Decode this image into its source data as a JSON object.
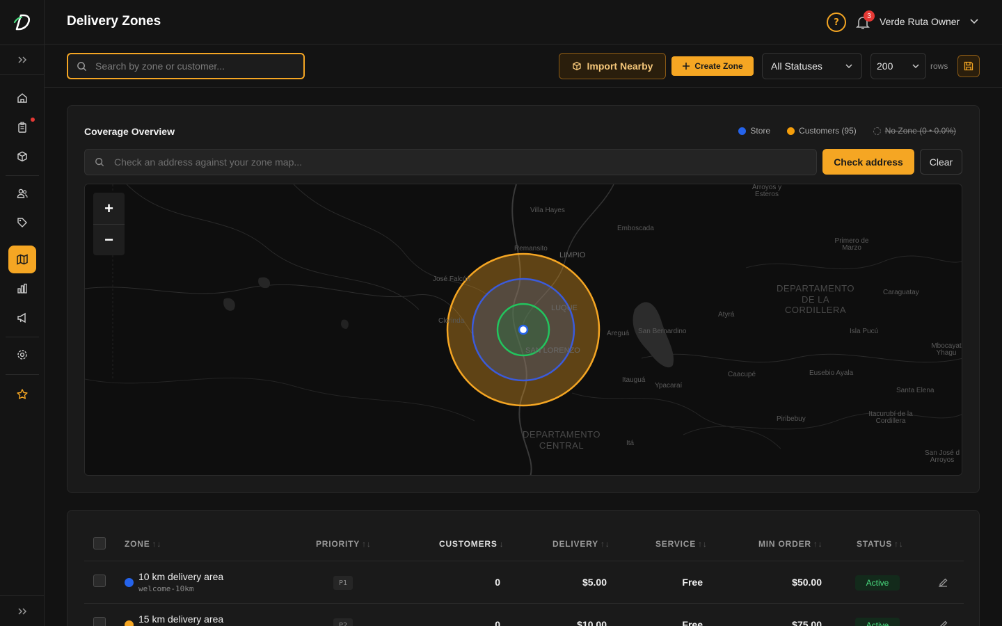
{
  "header": {
    "title": "Delivery Zones",
    "notification_count": "3",
    "user_name": "Verde Ruta Owner",
    "help_glyph": "?"
  },
  "toolbar": {
    "search_placeholder": "Search by zone or customer...",
    "import_label": "Import Nearby",
    "create_label": "Create Zone",
    "status_value": "All Statuses",
    "rows_value": "200",
    "rows_label": "rows"
  },
  "coverage": {
    "title": "Coverage Overview",
    "legend": [
      {
        "label": "Store",
        "color": "#2563eb"
      },
      {
        "label": "Customers (95)",
        "color": "#f59e0b"
      },
      {
        "label": "No Zone (0 • 0.0%)",
        "color": "#666666"
      }
    ],
    "address_placeholder": "Check an address against your zone map...",
    "check_label": "Check address",
    "clear_label": "Clear",
    "zoom_in": "+",
    "zoom_out": "−",
    "map_labels": {
      "arroyos": "Arroyos y Esteros",
      "villa_hayes": "Villa Hayes",
      "emboscada": "Emboscada",
      "primero_de_marzo": "Primero de Marzo",
      "remansito": "Remansito",
      "limpio": "LIMPIO",
      "jose_falcon": "José Falcón",
      "luque": "LUQUE",
      "clorinda": "Clorinda",
      "san_lorenzo": "SAN LORENZO",
      "areguá": "Areguá",
      "san_bernardino": "San Bernardino",
      "atyra": "Atyrá",
      "dept_cordillera": "DEPARTAMENTO DE LA CORDILLERA",
      "caraguatay": "Caraguatay",
      "isla_pucu": "Isla Pucú",
      "mbocayaty": "Mbocayat Yhagu",
      "itagua": "Itauguá",
      "ypacarai": "Ypacaraí",
      "caacupe": "Caacupé",
      "eusebio_ayala": "Eusebio Ayala",
      "santa_elena": "Santa Elena",
      "piribebuy": "Piribebuy",
      "itacurubi": "Itacurubí de la Cordillera",
      "dept_central": "DEPARTAMENTO CENTRAL",
      "ita": "Itá",
      "san_jose": "San José d Arroyos"
    },
    "zone_colors": {
      "inner": "#22c55e",
      "middle": "#3b5bdb",
      "outer": "#f5a623"
    }
  },
  "table": {
    "columns": [
      "ZONE",
      "PRIORITY",
      "CUSTOMERS",
      "DELIVERY",
      "SERVICE",
      "MIN ORDER",
      "STATUS"
    ],
    "sort_glyph": "↑↓",
    "sort_active_glyph": "↓",
    "rows": [
      {
        "color": "#2563eb",
        "name": "10 km delivery area",
        "code": "welcome-10km",
        "priority": "P1",
        "customers": "0",
        "delivery": "$5.00",
        "service": "Free",
        "min_order": "$50.00",
        "status": "Active"
      },
      {
        "color": "#f5a623",
        "name": "15 km delivery area",
        "code": "",
        "priority": "P2",
        "customers": "0",
        "delivery": "$10.00",
        "service": "Free",
        "min_order": "$75.00",
        "status": "Active"
      }
    ]
  },
  "colors": {
    "accent": "#f5a623",
    "background": "#121212",
    "status_green": "#4ade80"
  }
}
